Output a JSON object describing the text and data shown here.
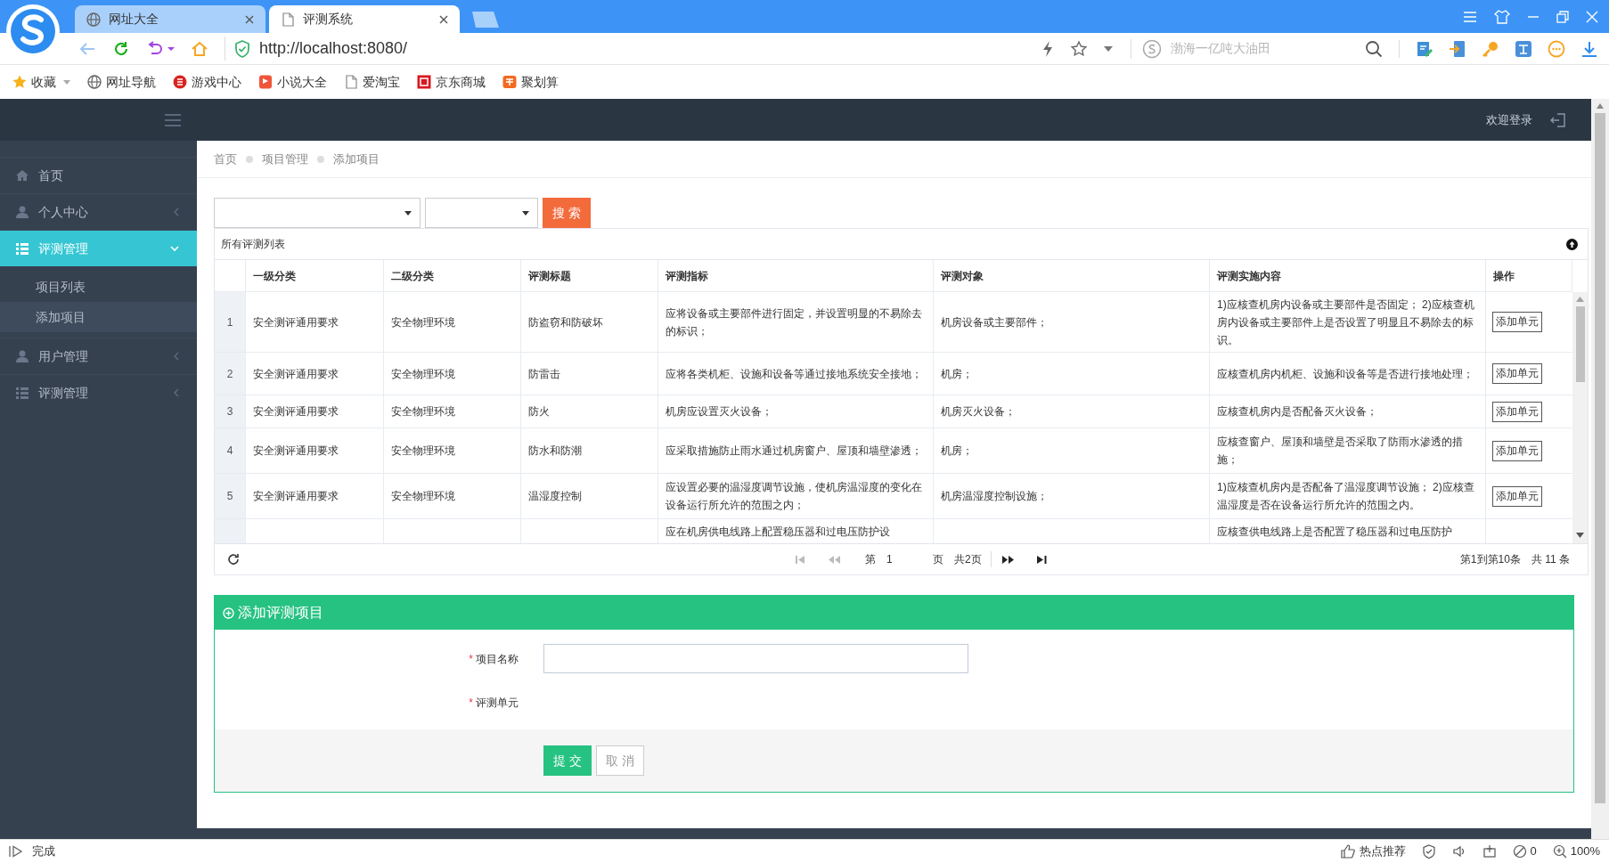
{
  "browser": {
    "tabs": [
      {
        "title": "网址大全",
        "selected": false
      },
      {
        "title": "评测系统",
        "selected": true
      }
    ],
    "address": "http://localhost:8080/",
    "search_placeholder": "渤海一亿吨大油田",
    "bookmarks": [
      {
        "label": "收藏",
        "dropdown": true
      },
      {
        "label": "网址导航"
      },
      {
        "label": "游戏中心"
      },
      {
        "label": "小说大全"
      },
      {
        "label": "爱淘宝"
      },
      {
        "label": "京东商城"
      },
      {
        "label": "聚划算"
      }
    ],
    "status": {
      "text": "完成",
      "hot": "热点推荐",
      "ad_count": "0",
      "zoom": "100%"
    }
  },
  "app": {
    "header": {
      "welcome": "欢迎登录"
    },
    "sidebar": [
      {
        "label": "首页",
        "kind": "link",
        "selected": false
      },
      {
        "label": "个人中心",
        "kind": "menu",
        "expanded": false,
        "selected": false
      },
      {
        "label": "评测管理",
        "kind": "menu",
        "expanded": true,
        "selected": true,
        "children": [
          {
            "label": "项目列表",
            "selected": false
          },
          {
            "label": "添加项目",
            "selected": true
          }
        ]
      },
      {
        "label": "用户管理",
        "kind": "menu",
        "expanded": false,
        "selected": false
      },
      {
        "label": "评测管理",
        "kind": "menu",
        "expanded": false,
        "selected": false
      }
    ],
    "breadcrumb": [
      "首页",
      "项目管理",
      "添加项目"
    ],
    "search": {
      "button": "搜 索"
    },
    "table": {
      "title": "所有评测列表",
      "columns": [
        "一级分类",
        "二级分类",
        "评测标题",
        "评测指标",
        "评测对象",
        "评测实施内容",
        "操作"
      ],
      "rows": [
        {
          "number": "1",
          "level1": "安全测评通用要求",
          "level2": "安全物理环境",
          "title": "防盗窃和防破坏",
          "indicator": "应将设备或主要部件进行固定，并设置明显的不易除去的标识；",
          "target": "机房设备或主要部件；",
          "content": "1)应核查机房内设备或主要部件是否固定； 2)应核查机房内设备或主要部件上是否设置了明显且不易除去的标识。",
          "action": "添加单元"
        },
        {
          "number": "2",
          "level1": "安全测评通用要求",
          "level2": "安全物理环境",
          "title": "防雷击",
          "indicator": "应将各类机柜、设施和设备等通过接地系统安全接地；",
          "target": "机房；",
          "content": "应核查机房内机柜、设施和设备等是否进行接地处理；",
          "action": "添加单元"
        },
        {
          "number": "3",
          "level1": "安全测评通用要求",
          "level2": "安全物理环境",
          "title": "防火",
          "indicator": "机房应设置灭火设备；",
          "target": "机房灭火设备；",
          "content": "应核查机房内是否配备灭火设备；",
          "action": "添加单元"
        },
        {
          "number": "4",
          "level1": "安全测评通用要求",
          "level2": "安全物理环境",
          "title": "防水和防潮",
          "indicator": "应采取措施防止雨水通过机房窗户、屋顶和墙壁渗透；",
          "target": "机房；",
          "content": "应核查窗户、屋顶和墙壁是否采取了防雨水渗透的措施；",
          "action": "添加单元"
        },
        {
          "number": "5",
          "level1": "安全测评通用要求",
          "level2": "安全物理环境",
          "title": "温湿度控制",
          "indicator": "应设置必要的温湿度调节设施，使机房温湿度的变化在设备运行所允许的范围之内；",
          "target": "机房温湿度控制设施；",
          "content": "1)应核查机房内是否配备了温湿度调节设施； 2)应核查温湿度是否在设备运行所允许的范围之内。",
          "action": "添加单元"
        },
        {
          "indicator": "应在机房供电线路上配置稳压器和过电压防护设",
          "content": "应核查供电线路上是否配置了稳压器和过电压防护"
        }
      ]
    },
    "pagination": {
      "page_prefix": "第",
      "page": "1",
      "page_suffix": "页",
      "total_pages": "共2页",
      "range": "第1到第10条",
      "total": "共 11 条"
    },
    "form": {
      "title": "添加评测项目",
      "fields": [
        {
          "label": "项目名称",
          "required_mark": "*",
          "kind": "input"
        },
        {
          "label": "评测单元",
          "required_mark": "*",
          "kind": "none"
        }
      ],
      "buttons": [
        {
          "label": "提 交",
          "kind": "primary"
        },
        {
          "label": "取 消",
          "kind": "default"
        }
      ]
    }
  }
}
